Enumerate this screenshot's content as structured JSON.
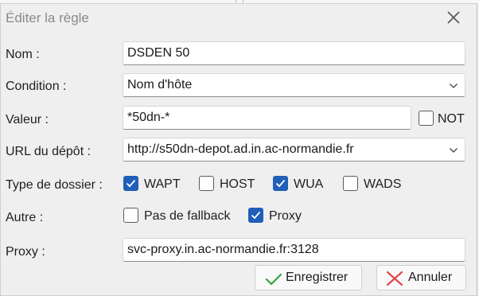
{
  "dialog": {
    "title": "Éditer la règle",
    "close_icon": "close-icon"
  },
  "form": {
    "nom": {
      "label": "Nom :",
      "value": "DSDEN 50"
    },
    "condition": {
      "label": "Condition :",
      "value": "Nom d'hôte"
    },
    "valeur": {
      "label": "Valeur :",
      "value": "*50dn-*",
      "not_label": "NOT",
      "not_checked": false
    },
    "url": {
      "label": "URL du dépôt :",
      "value": "http://s50dn-depot.ad.in.ac-normandie.fr"
    },
    "type_dossier": {
      "label": "Type de dossier :",
      "options": [
        {
          "label": "WAPT",
          "checked": true
        },
        {
          "label": "HOST",
          "checked": false
        },
        {
          "label": "WUA",
          "checked": true
        },
        {
          "label": "WADS",
          "checked": false
        }
      ]
    },
    "autre": {
      "label": "Autre :",
      "options": [
        {
          "label": "Pas de fallback",
          "checked": false
        },
        {
          "label": "Proxy",
          "checked": true
        }
      ]
    },
    "proxy": {
      "label": "Proxy :",
      "value": "svc-proxy.in.ac-normandie.fr:3128"
    }
  },
  "buttons": {
    "save_label": "Enregistrer",
    "save_icon": "checkmark-icon",
    "cancel_label": "Annuler",
    "cancel_icon": "cross-icon"
  },
  "colors": {
    "accent": "#1f5fb8",
    "save_check": "#3aa53a",
    "cancel_cross": "#e0474c"
  }
}
